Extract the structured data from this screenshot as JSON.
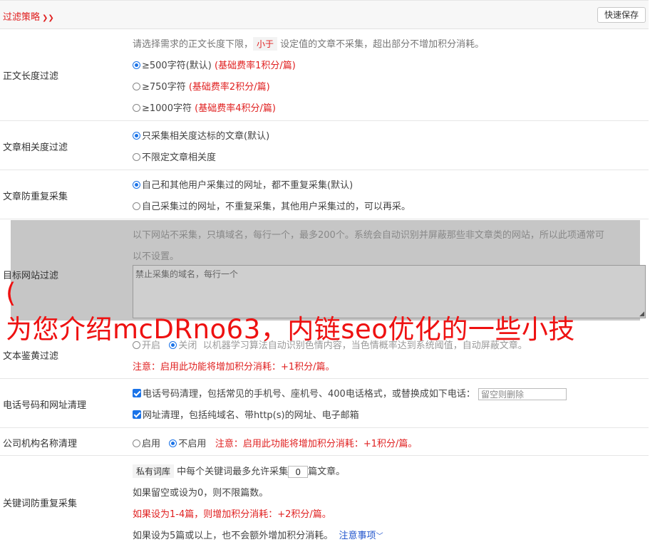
{
  "header": {
    "title": "过滤策略",
    "chevron_icon": "double-chevron-down-icon",
    "save_button": "快速保存"
  },
  "length_filter": {
    "label": "正文长度过滤",
    "desc_pre": "请选择需求的正文长度下限，",
    "desc_tag": "小于",
    "desc_post": "设定值的文章不采集，超出部分不增加积分消耗。",
    "options": [
      {
        "text": "≥500字符(默认)",
        "note": "(基础费率1积分/篇)",
        "selected": true
      },
      {
        "text": "≥750字符",
        "note": "(基础费率2积分/篇)",
        "selected": false
      },
      {
        "text": "≥1000字符",
        "note": "(基础费率4积分/篇)",
        "selected": false
      }
    ]
  },
  "relevance_filter": {
    "label": "文章相关度过滤",
    "options": [
      {
        "text": "只采集相关度达标的文章(默认)",
        "selected": true
      },
      {
        "text": "不限定文章相关度",
        "selected": false
      }
    ]
  },
  "duplicate_filter": {
    "label": "文章防重复采集",
    "options": [
      {
        "text": "自己和其他用户采集过的网址，都不重复采集(默认)",
        "selected": true
      },
      {
        "text": "自己采集过的网址，不重复采集，其他用户采集过的，可以再采。",
        "selected": false
      }
    ]
  },
  "site_filter": {
    "label": "目标网站过滤",
    "desc_line1": "以下网站不采集，只填域名，每行一个，最多200个。系统会自动识别并屏蔽那些非文章类的网站，所以此项通常可",
    "desc_line2": "以不设置。",
    "textarea_placeholder": "禁止采集的域名，每行一个"
  },
  "watermark": {
    "paren": "(",
    "text": "为您介绍mcDRno63，内链seo优化的一些小技"
  },
  "porn_filter": {
    "label": "文本鉴黄过滤",
    "option_on": "开启",
    "option_off": "关闭",
    "desc": "以机器学习算法自动识别色情内容，当色情概率达到系统阈值，自动屏蔽文章。",
    "note": "注意：启用此功能将增加积分消耗：+1积分/篇。"
  },
  "contact_filter": {
    "label": "电话号码和网址清理",
    "phone_text": "电话号码清理，包括常见的手机号、座机号、400电话格式，或替换成如下电话：",
    "phone_placeholder": "留空则删除",
    "url_text": "网址清理，包括纯域名、带http(s)的网址、电子邮箱"
  },
  "org_filter": {
    "label": "公司机构名称清理",
    "option_on": "启用",
    "option_off": "不启用",
    "note": "注意：启用此功能将增加积分消耗：+1积分/篇。"
  },
  "keyword_filter": {
    "label": "关键词防重复采集",
    "tag": "私有词库",
    "text_pre": "中每个关键词最多允许采集",
    "value": "0",
    "text_post": "篇文章。",
    "line2": "如果留空或设为0，则不限篇数。",
    "line3": "如果设为1-4篇，则增加积分消耗：+2积分/篇。",
    "line4": "如果设为5篇或以上，也不会额外增加积分消耗。",
    "link": "注意事项",
    "link_icon": "chevron-down-icon"
  },
  "colors": {
    "accent": "#e02020",
    "link": "#2255cc",
    "radio": "#1a73e8"
  }
}
